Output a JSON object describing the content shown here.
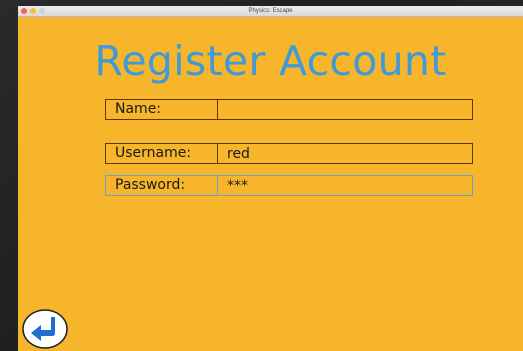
{
  "window": {
    "title": "Physics: Escape"
  },
  "page": {
    "title": "Register Account"
  },
  "form": {
    "name": {
      "label": "Name:",
      "value": ""
    },
    "username": {
      "label": "Username:",
      "value": "red"
    },
    "password": {
      "label": "Password:",
      "value": "***"
    }
  },
  "back_button": {
    "icon": "return-arrow-icon"
  },
  "colors": {
    "background": "#f7b52b",
    "title": "#3e9bd8",
    "border": "#5a3a00",
    "focus_border": "#6fa0c8",
    "back_icon": "#1e6fd0"
  }
}
